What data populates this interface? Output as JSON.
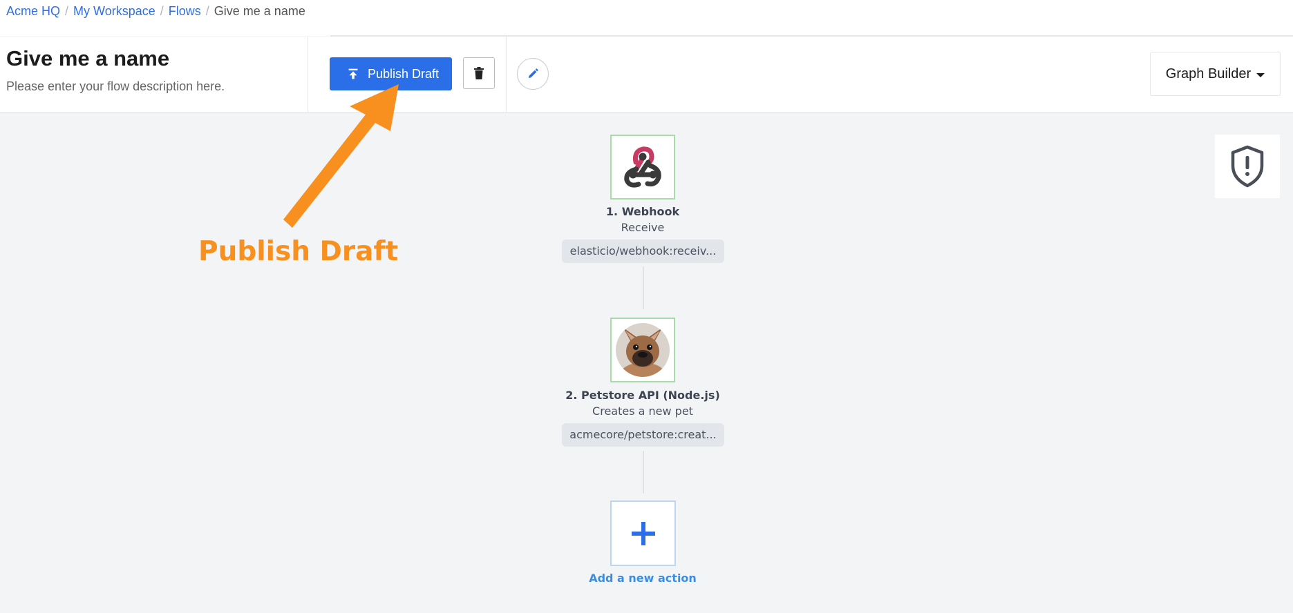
{
  "breadcrumb": {
    "items": [
      "Acme HQ",
      "My Workspace",
      "Flows"
    ],
    "separator": "/",
    "current": "Give me a name"
  },
  "flow": {
    "title": "Give me a name",
    "description": "Please enter your flow description here."
  },
  "toolbar": {
    "publish_label": "Publish Draft",
    "builder_label": "Graph Builder"
  },
  "nodes": [
    {
      "title": "1. Webhook",
      "subtitle": "Receive",
      "component": "elasticio/webhook:receiv...",
      "icon": "webhook-icon"
    },
    {
      "title": "2. Petstore API (Node.js)",
      "subtitle": "Creates a new pet",
      "component": "acmecore/petstore:creat...",
      "icon": "french-bulldog-avatar"
    }
  ],
  "add_action": {
    "label": "Add a new action",
    "icon": "plus-icon"
  },
  "annotation": {
    "text": "Publish Draft",
    "color": "#f7901e"
  },
  "colors": {
    "accent": "#2a6fe8",
    "link": "#2f6fe0",
    "node_border": "#a7dba7",
    "add_label": "#3b8de0"
  },
  "icons": {
    "publish": "upload-icon",
    "delete": "trash-icon",
    "edit": "pencil-icon",
    "security": "shield-alert-icon"
  }
}
